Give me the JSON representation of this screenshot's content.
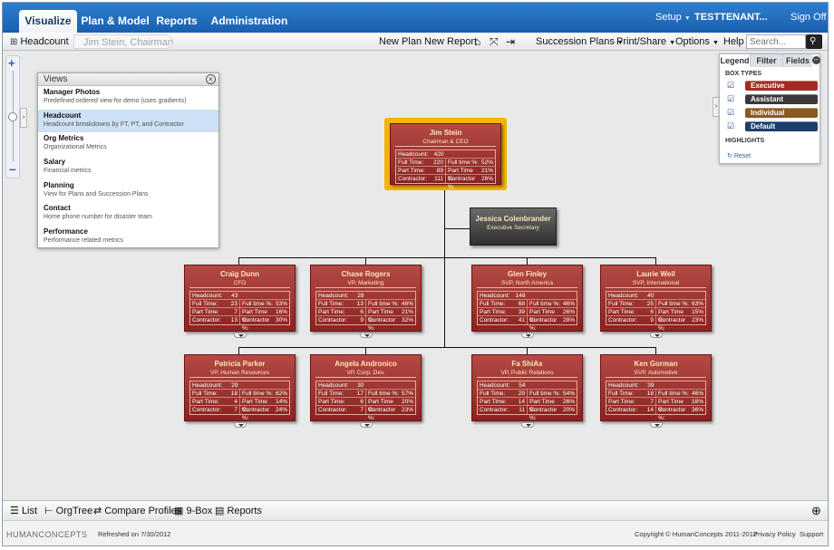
{
  "nav": {
    "tabs": [
      "Visualize",
      "Plan & Model",
      "Reports",
      "Administration"
    ],
    "setup": "Setup",
    "tenant": "TESTTENANT...",
    "signoff": "Sign Off"
  },
  "toolbar": {
    "view": "Headcount",
    "crumb": "Jim Stein, Chairman &...",
    "new_plan": "New Plan",
    "new_report": "New Report",
    "succession": "Succession Plans",
    "print": "Print/Share",
    "options": "Options",
    "help": "Help",
    "search_placeholder": "Search..."
  },
  "views": {
    "title": "Views",
    "items": [
      {
        "t": "Manager Photos",
        "d": "Predefined ordered view for demo (uses gradients)"
      },
      {
        "t": "Headcount",
        "d": "Headcount breakdowns by FT, PT, and Contractor"
      },
      {
        "t": "Org Metrics",
        "d": "Organizational Metrics"
      },
      {
        "t": "Salary",
        "d": "Financial metrics"
      },
      {
        "t": "Planning",
        "d": "View for Plans and Succession Plans"
      },
      {
        "t": "Contact",
        "d": "Home phone number for disaster team"
      },
      {
        "t": "Performance",
        "d": "Performance related metrics"
      }
    ]
  },
  "labels": {
    "headcount": "Headcount:",
    "fulltime": "Full Time:",
    "parttime": "Part Time:",
    "contractor": "Contractor:",
    "ftp": "Full time %:",
    "ptp": "Part Time %:",
    "cp": "Contractor %:"
  },
  "org": {
    "root": {
      "name": "Jim Stein",
      "title": "Chairman & CEO",
      "hc": "420",
      "ft": "220",
      "pt": "89",
      "ct": "111",
      "ftp": "52%",
      "ptp": "21%",
      "cp": "26%"
    },
    "assistant": {
      "name": "Jessica Colenbrander",
      "title": "Executive Secretary"
    },
    "row1": [
      {
        "name": "Craig Dunn",
        "title": "CFO",
        "hc": "43",
        "ft": "23",
        "pt": "7",
        "ct": "13",
        "ftp": "53%",
        "ptp": "16%",
        "cp": "30%"
      },
      {
        "name": "Chase Rogers",
        "title": "VP, Marketing",
        "hc": "28",
        "ft": "13",
        "pt": "6",
        "ct": "9",
        "ftp": "46%",
        "ptp": "21%",
        "cp": "32%"
      },
      {
        "name": "Glen Finley",
        "title": "SVP, North America",
        "hc": "148",
        "ft": "68",
        "pt": "39",
        "ct": "41",
        "ftp": "46%",
        "ptp": "26%",
        "cp": "28%"
      },
      {
        "name": "Laurie Weil",
        "title": "SVP, International",
        "hc": "40",
        "ft": "25",
        "pt": "6",
        "ct": "9",
        "ftp": "63%",
        "ptp": "15%",
        "cp": "23%"
      }
    ],
    "row2": [
      {
        "name": "Patricia Parker",
        "title": "VP, Human Resources",
        "hc": "29",
        "ft": "18",
        "pt": "4",
        "ct": "7",
        "ftp": "62%",
        "ptp": "14%",
        "cp": "24%"
      },
      {
        "name": "Angela Andronico",
        "title": "VP, Corp. Dev.",
        "hc": "30",
        "ft": "17",
        "pt": "6",
        "ct": "7",
        "ftp": "57%",
        "ptp": "20%",
        "cp": "23%"
      },
      {
        "name": "Fa ShiAs",
        "title": "VP, Public Relations",
        "hc": "54",
        "ft": "29",
        "pt": "14",
        "ct": "11",
        "ftp": "54%",
        "ptp": "26%",
        "cp": "20%"
      },
      {
        "name": "Ken Gorman",
        "title": "SVP, Automotive",
        "hc": "39",
        "ft": "18",
        "pt": "7",
        "ct": "14",
        "ftp": "46%",
        "ptp": "18%",
        "cp": "36%"
      }
    ]
  },
  "legend": {
    "tabs": [
      "Legend",
      "Filter",
      "Fields"
    ],
    "box_types": "BOX TYPES",
    "highlights": "HIGHLIGHTS",
    "reset": "Reset",
    "items": [
      {
        "label": "Executive",
        "color": "#a52a26"
      },
      {
        "label": "Assistant",
        "color": "#3a3a3a"
      },
      {
        "label": "Individual Contributor",
        "color": "#8a5a22"
      },
      {
        "label": "Default",
        "color": "#1c3f6e"
      }
    ]
  },
  "bottom": {
    "list": "List",
    "orgtree": "OrgTree",
    "compare": "Compare Profiles",
    "ninebox": "9-Box",
    "reports": "Reports"
  },
  "footer": {
    "logo": "HUMANCONCEPTS",
    "refreshed": "Refreshed on  7/30/2012",
    "copyright": "Copyright © HumanConcepts 2011-2012",
    "privacy": "Privacy Policy",
    "support": "Support"
  }
}
